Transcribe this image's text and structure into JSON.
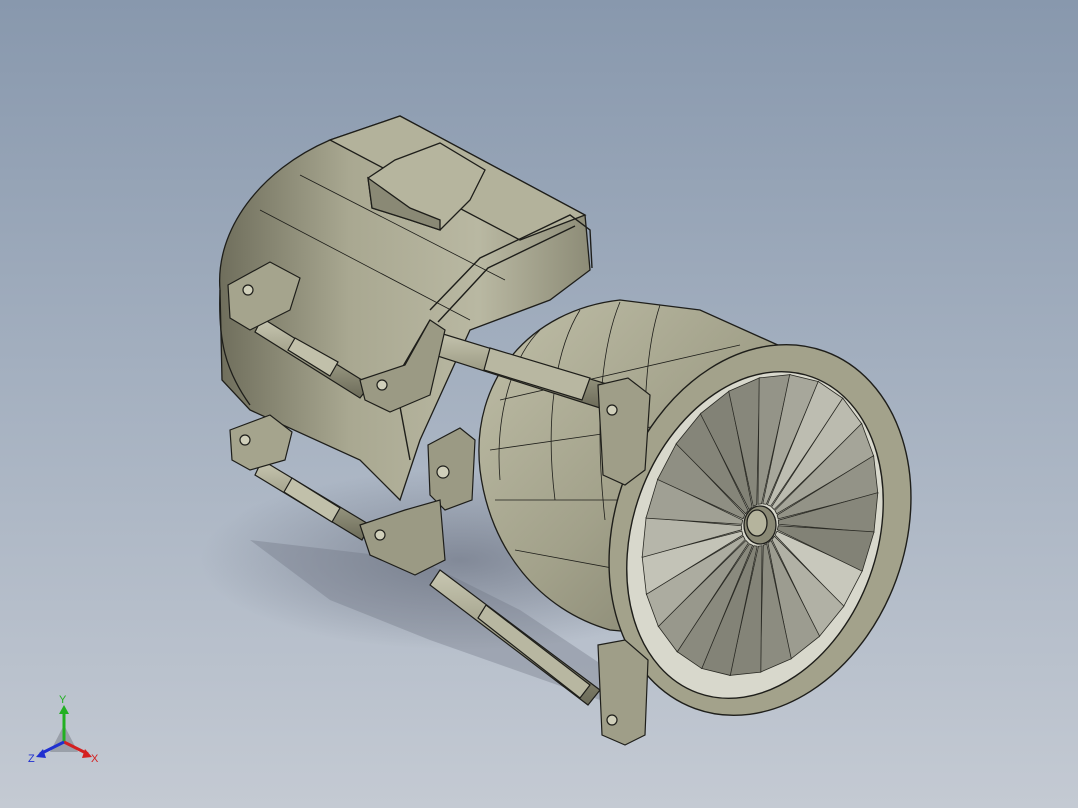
{
  "viewport": {
    "background_top": "#8898ad",
    "background_bottom": "#c4cad3",
    "model": {
      "part_color": "#a9a891",
      "part_shadow": "#7c7b68",
      "edge_color": "#1e1e1a",
      "blade_count": 24
    }
  },
  "triad": {
    "x_label": "X",
    "y_label": "Y",
    "z_label": "Z",
    "x_color": "#d42020",
    "y_color": "#22b022",
    "z_color": "#2030d0"
  }
}
